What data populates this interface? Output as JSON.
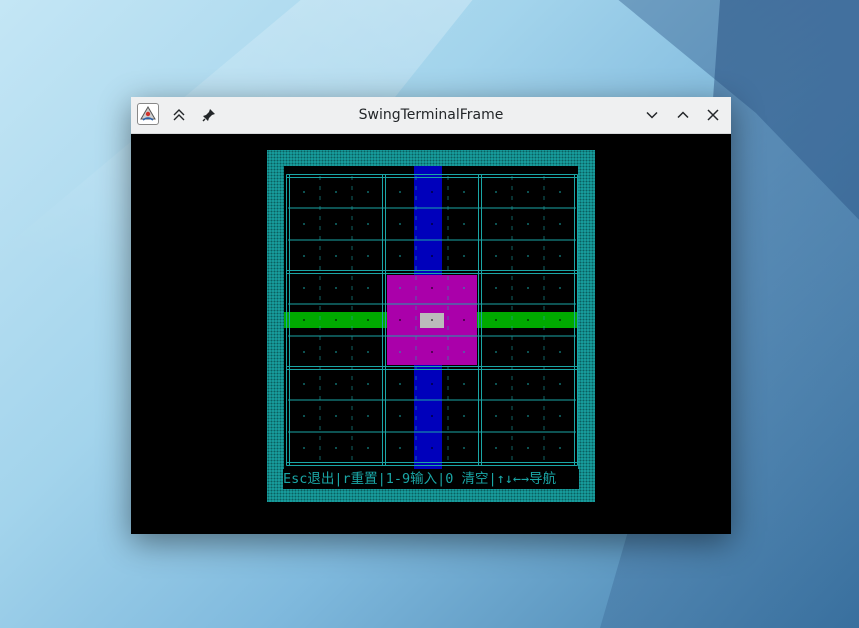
{
  "window": {
    "title": "SwingTerminalFrame"
  },
  "titlebar_buttons": {
    "keep_above": "keep-above",
    "pin": "pin",
    "minimize": "minimize",
    "maximize": "maximize",
    "close": "close"
  },
  "colors": {
    "terminal_bg": "#000000",
    "frame_cyan": "#1aa6a6",
    "grid_line": "#1aa6a6",
    "highlight_blue": "#0000bb",
    "highlight_green": "#00aa00",
    "highlight_magenta": "#aa00aa",
    "cursor_gray": "#bbbbbb"
  },
  "board": {
    "rows": 9,
    "cols": 9,
    "selected_row": 5,
    "selected_col": 5
  },
  "status_bar": {
    "text": "Esc退出|r重置|1-9输入|0 清空|↑↓←→导航"
  }
}
